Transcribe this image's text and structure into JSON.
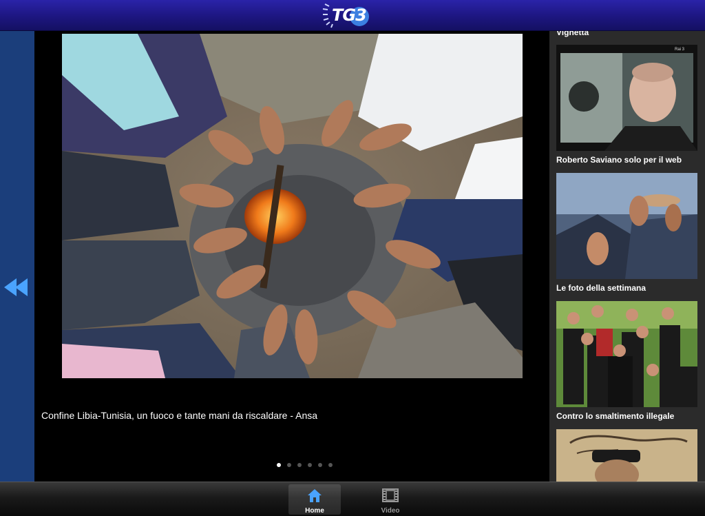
{
  "header": {
    "logo_text": "TG3"
  },
  "gallery": {
    "caption": "Confine Libia-Tunisia, un fuoco e tante mani da riscaldare - Ansa",
    "page_count": 6,
    "active_page": 1
  },
  "sidebar": {
    "items": [
      {
        "title": "Vignetta"
      },
      {
        "title": "Roberto Saviano solo per il web"
      },
      {
        "title": "Le foto della settimana"
      },
      {
        "title": "Contro lo smaltimento illegale"
      }
    ]
  },
  "tabbar": {
    "tabs": [
      {
        "label": "Home",
        "icon": "home-icon",
        "active": true
      },
      {
        "label": "Video",
        "icon": "film-icon",
        "active": false
      }
    ]
  },
  "colors": {
    "header_blue": "#1d1680",
    "nav_blue": "#1b3e7b",
    "accent_blue": "#4aa3ff"
  }
}
